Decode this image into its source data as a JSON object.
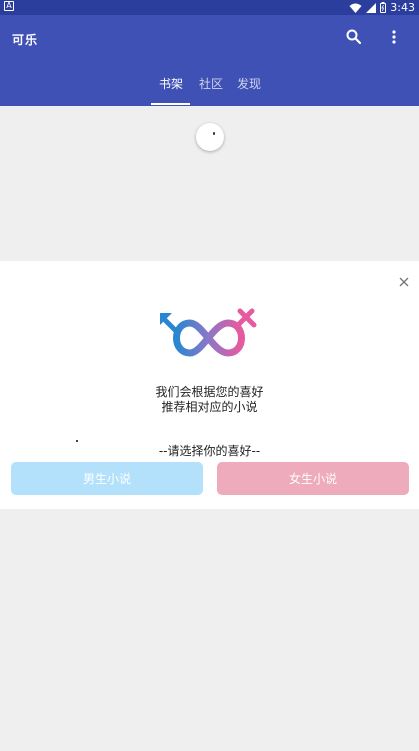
{
  "status_bar": {
    "left_icon": "A",
    "time": "3:43",
    "icons": [
      "wifi-icon",
      "signal-icon",
      "battery-icon"
    ]
  },
  "app_bar": {
    "title": "可乐",
    "actions": [
      "search-icon",
      "more-vert-icon"
    ],
    "color": "#3f51b5"
  },
  "tabs": {
    "items": [
      {
        "label": "书架",
        "active": true
      },
      {
        "label": "社区",
        "active": false
      },
      {
        "label": "发现",
        "active": false
      }
    ]
  },
  "dialog": {
    "message_line1": "我们会根据您的喜好",
    "message_line2": "推荐相对应的小说",
    "choose_label": "--请选择你的喜好--",
    "male_button": "男生小说",
    "female_button": "女生小说",
    "male_color": "#b3e1fc",
    "female_color": "#eeabbb"
  }
}
